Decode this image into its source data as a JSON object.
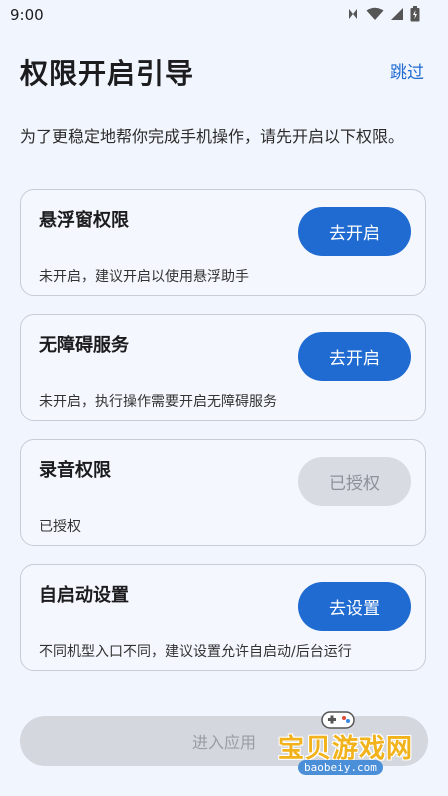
{
  "status": {
    "time": "9:00"
  },
  "header": {
    "title": "权限开启引导",
    "skip_label": "跳过"
  },
  "intro": "为了更稳定地帮你完成手机操作，请先开启以下权限。",
  "cards": [
    {
      "title": "悬浮窗权限",
      "desc": "未开启，建议开启以使用悬浮助手",
      "button": "去开启",
      "enabled": true
    },
    {
      "title": "无障碍服务",
      "desc": "未开启，执行操作需要开启无障碍服务",
      "button": "去开启",
      "enabled": true
    },
    {
      "title": "录音权限",
      "desc": "已授权",
      "button": "已授权",
      "enabled": false
    },
    {
      "title": "自启动设置",
      "desc": "不同机型入口不同，建议设置允许自启动/后台运行",
      "button": "去设置",
      "enabled": true
    }
  ],
  "footer": {
    "enter_label": "进入应用"
  },
  "watermark": {
    "text": "宝贝游戏网",
    "url": "baobeiy.com"
  },
  "colors": {
    "accent": "#1f6bd1",
    "background": "#f1f5fd",
    "disabled": "#d8dbe2"
  }
}
